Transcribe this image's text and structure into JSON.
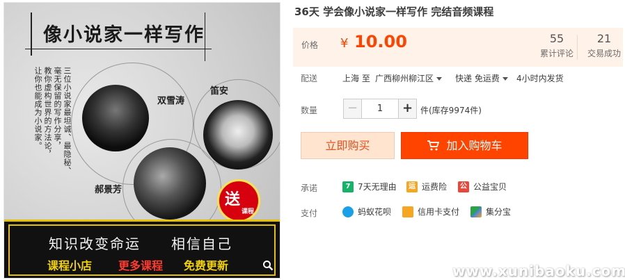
{
  "image": {
    "title": "像小说家一样写作",
    "vertical_text": [
      "三位小说家最坦诚、最隐秘、",
      "毫无保留的写作分享，",
      "教你虚构世界的方法论，",
      "让你也能成为小说家。"
    ],
    "authors": [
      "双雪涛",
      "笛安",
      "郝景芳"
    ],
    "badge_big": "送",
    "badge_small": "课程",
    "banner_line1_left": "知识改变命运",
    "banner_line1_right": "相信自己",
    "banner_line2": [
      "课程小店",
      "更多课程",
      "免费更新"
    ]
  },
  "product": {
    "title": "36天 学会像小说家一样写作 完结音频课程",
    "price_label": "价格",
    "currency": "¥",
    "price": "10.00",
    "reviews_count": "55",
    "reviews_label": "累计评论",
    "deals_count": "21",
    "deals_label": "交易成功"
  },
  "shipping": {
    "label": "配送",
    "from": "上海 至",
    "to": "广西柳州柳江区",
    "method": "快递 免运费",
    "time": "4小时内发货"
  },
  "quantity": {
    "label": "数量",
    "minus": "−",
    "value": "1",
    "plus": "+",
    "stock": "件(库存9974件)"
  },
  "buttons": {
    "buy_now": "立即购买",
    "add_cart": "加入购物车"
  },
  "promise": {
    "label": "承诺",
    "items": [
      {
        "icon": "7",
        "text": "7天无理由"
      },
      {
        "icon": "运",
        "text": "运费险"
      },
      {
        "icon": "公",
        "text": "公益宝贝"
      }
    ]
  },
  "payment": {
    "label": "支付",
    "items": [
      "蚂蚁花呗",
      "信用卡支付",
      "集分宝"
    ]
  },
  "watermark": "www.xunibaoku.com",
  "colors": {
    "accent": "#ff4400",
    "price": "#ff4400",
    "price_bg": "#fff2e8"
  }
}
